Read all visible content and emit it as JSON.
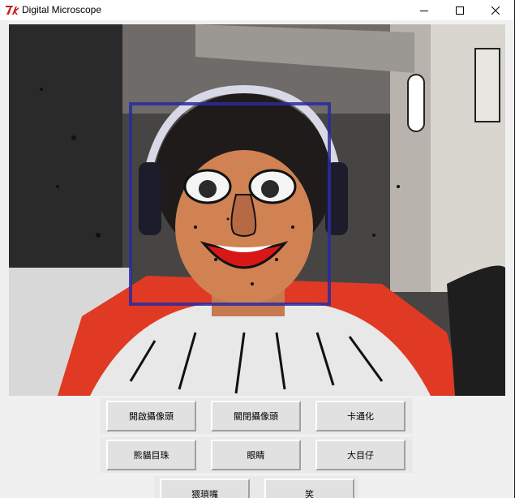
{
  "window": {
    "title": "Digital Microscope",
    "icon": "tk-feather-icon",
    "controls": [
      "minimize-icon",
      "maximize-icon",
      "close-icon"
    ]
  },
  "camera": {
    "face_box_color": "#2a2aa0"
  },
  "buttons": {
    "row1": [
      "開啟攝像頭",
      "關閉攝像頭",
      "卡通化"
    ],
    "row2": [
      "熊貓目珠",
      "眼睛",
      "大目仔"
    ],
    "row3": [
      "猥瑣嘴",
      "笑"
    ]
  },
  "colors": {
    "button_face": "#e1e1e1",
    "window_bg": "#f0f0f0",
    "titlebar_bg": "#ffffff"
  }
}
